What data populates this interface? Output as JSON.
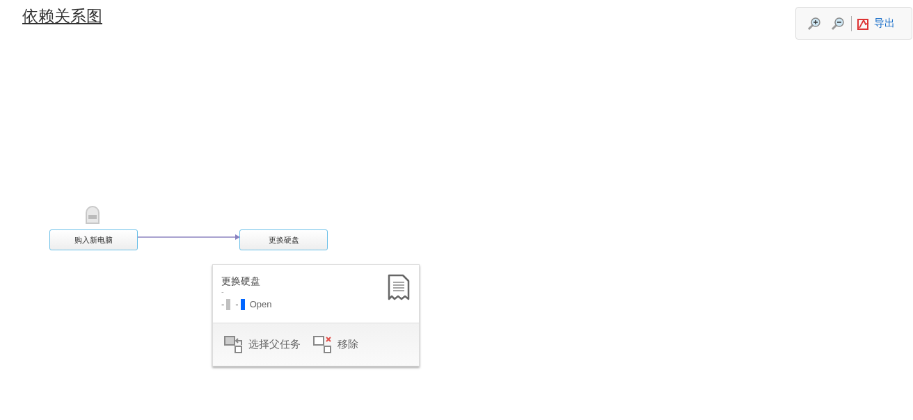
{
  "title": "依赖关系图",
  "toolbar": {
    "export_label": "导出"
  },
  "nodes": [
    {
      "label": "购入新电脑",
      "locked": true
    },
    {
      "label": "更换硬盘",
      "locked": false
    }
  ],
  "popup": {
    "title": "更换硬盘",
    "subtitle": "-",
    "markers": [
      {
        "text": "-",
        "color": "#c0c0c0"
      },
      {
        "text": "-",
        "color": "#0066ff"
      }
    ],
    "status": "Open",
    "actions": [
      {
        "kind": "parent",
        "label": "选择父任务"
      },
      {
        "kind": "remove",
        "label": "移除"
      }
    ]
  }
}
